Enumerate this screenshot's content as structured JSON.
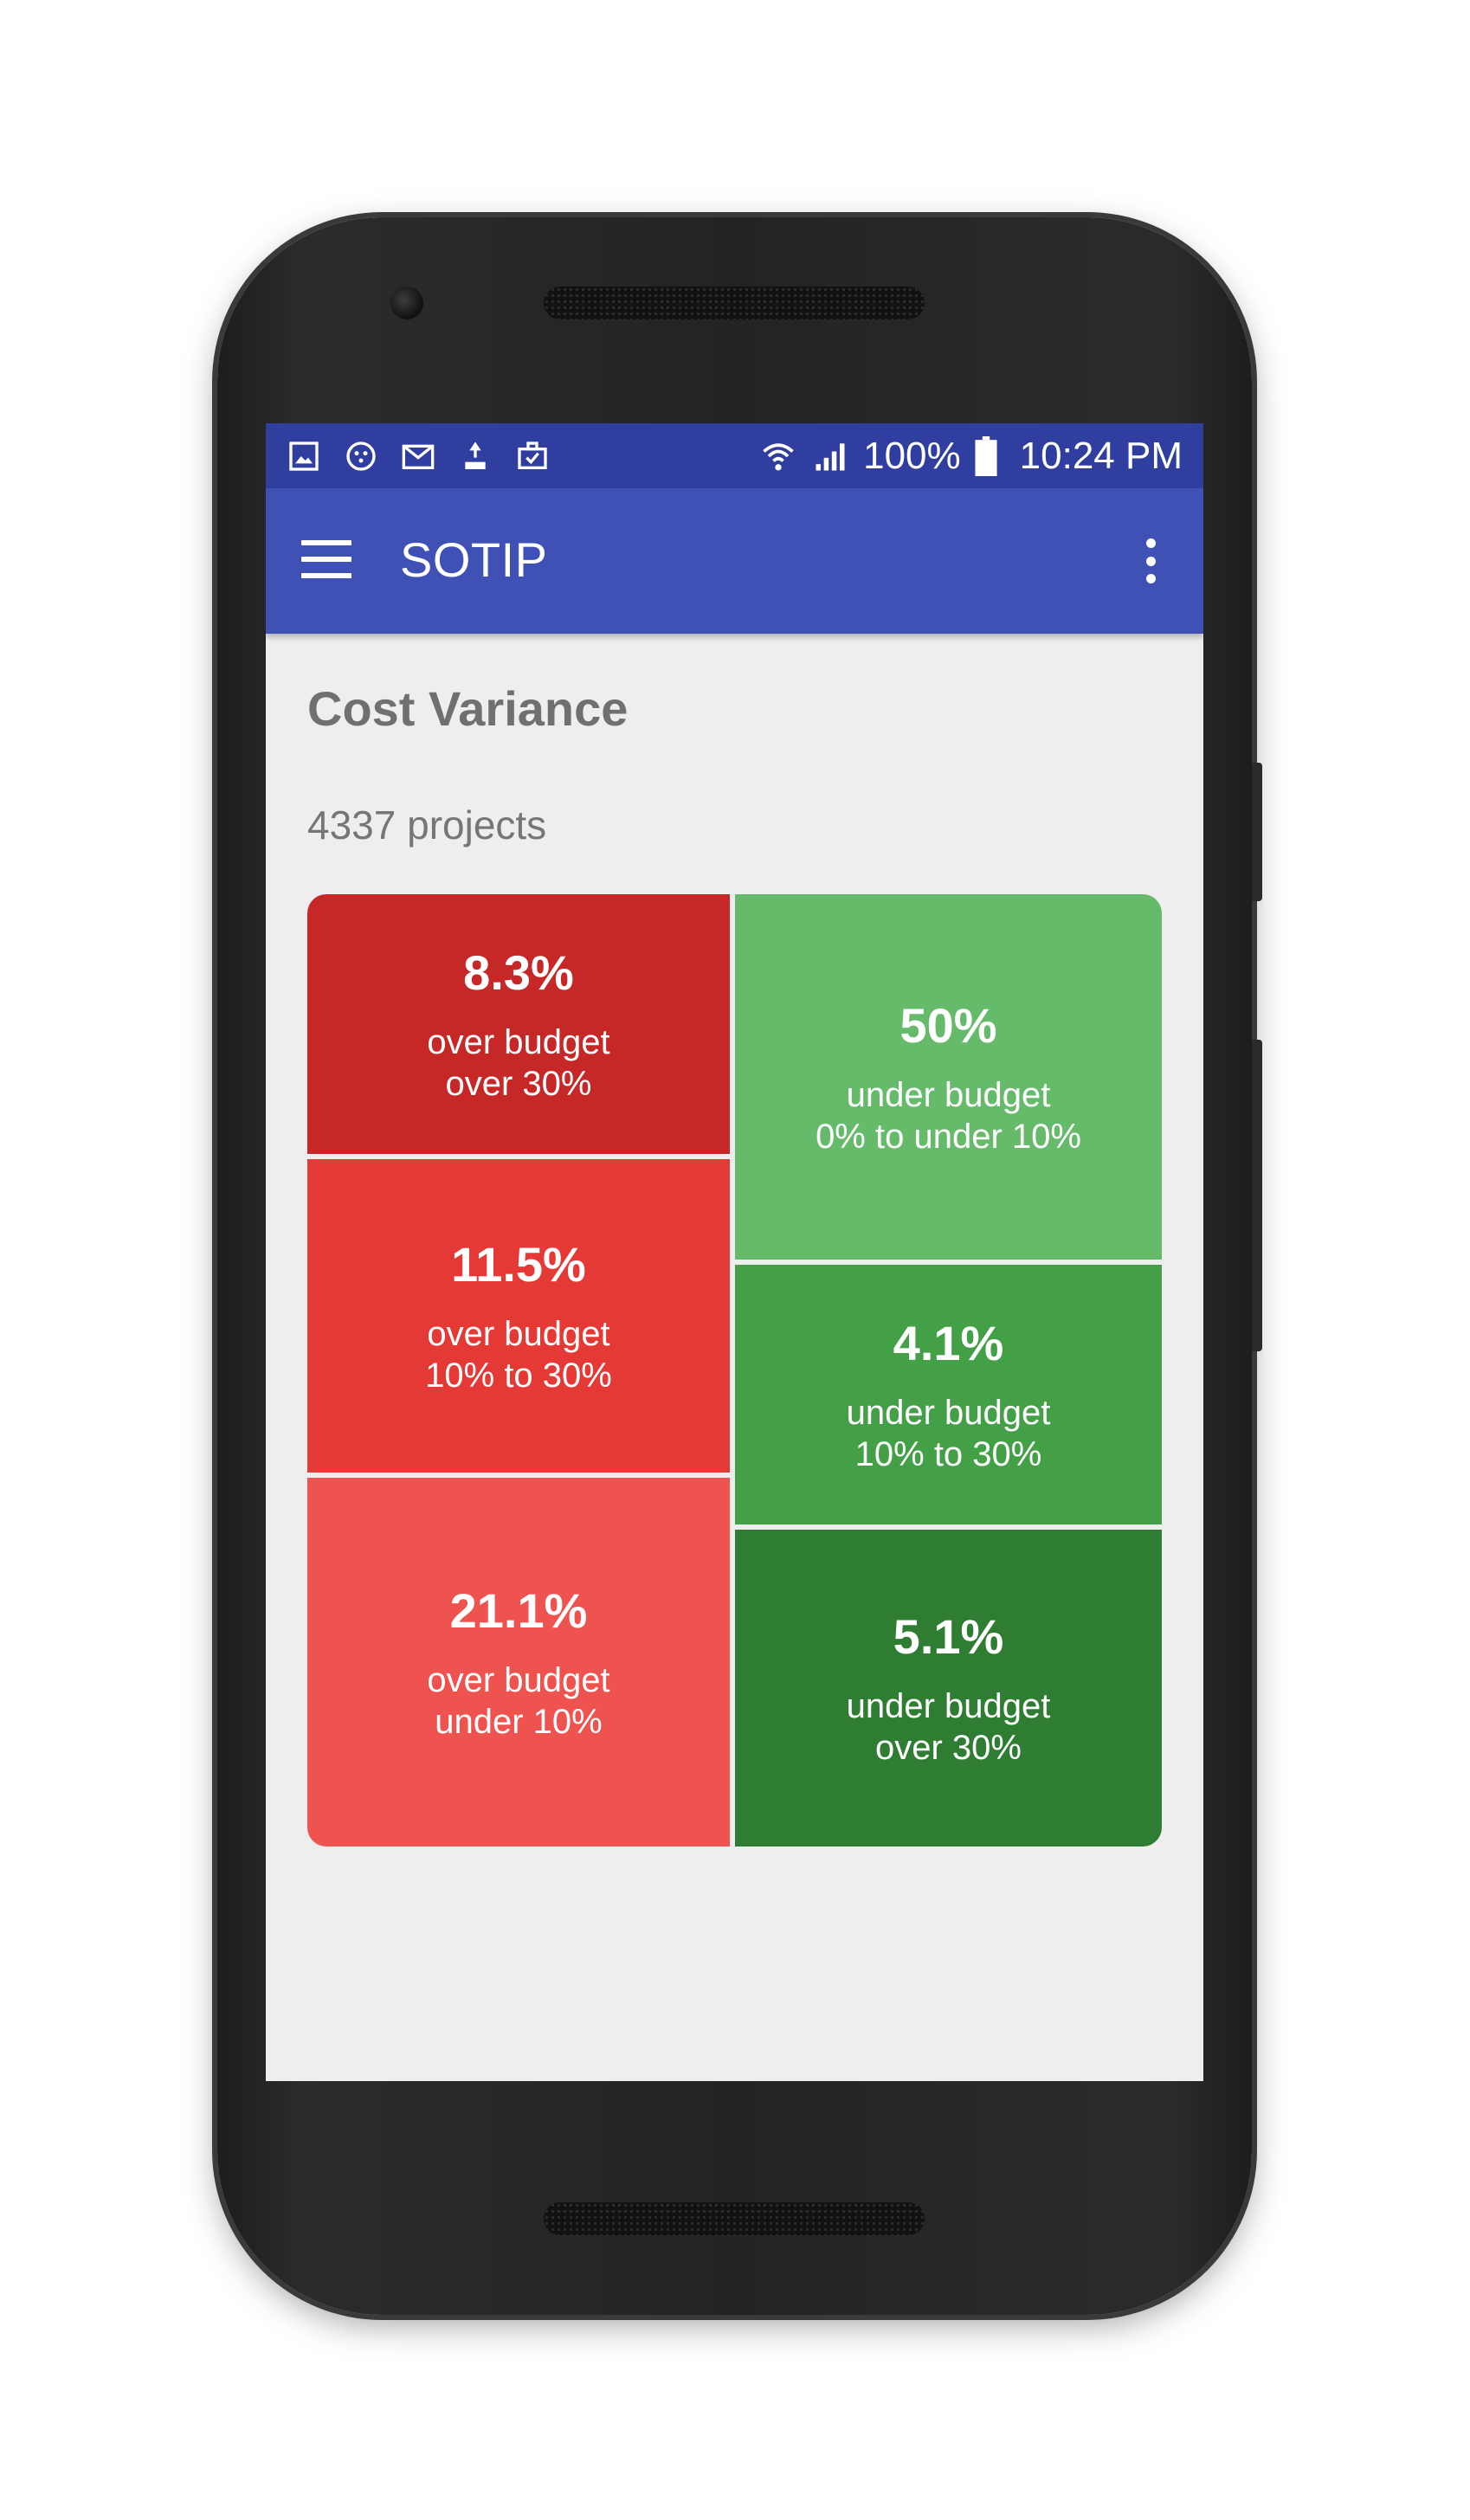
{
  "statusbar": {
    "battery": "100%",
    "time": "10:24 PM"
  },
  "toolbar": {
    "title": "SOTIP"
  },
  "page": {
    "title": "Cost Variance",
    "project_count": "4337 projects"
  },
  "tiles": {
    "over_30": {
      "pct": "8.3%",
      "line1": "over budget",
      "line2": "over 30%",
      "color": "#c62828"
    },
    "over_10_30": {
      "pct": "11.5%",
      "line1": "over budget",
      "line2": "10% to 30%",
      "color": "#e53935"
    },
    "over_under_10": {
      "pct": "21.1%",
      "line1": "over budget",
      "line2": "under 10%",
      "color": "#ef5350"
    },
    "under_0_10": {
      "pct": "50%",
      "line1": "under budget",
      "line2": "0% to under 10%",
      "color": "#66bb6a"
    },
    "under_10_30": {
      "pct": "4.1%",
      "line1": "under budget",
      "line2": "10% to 30%",
      "color": "#43a047"
    },
    "under_over_30": {
      "pct": "5.1%",
      "line1": "under budget",
      "line2": "over 30%",
      "color": "#2e7d32"
    }
  },
  "icons": [
    "image-icon",
    "face-icon",
    "mail-icon",
    "download-icon",
    "briefcase-icon",
    "wifi-icon",
    "signal-icon",
    "battery-icon",
    "menu-icon",
    "overflow-menu-icon"
  ]
}
